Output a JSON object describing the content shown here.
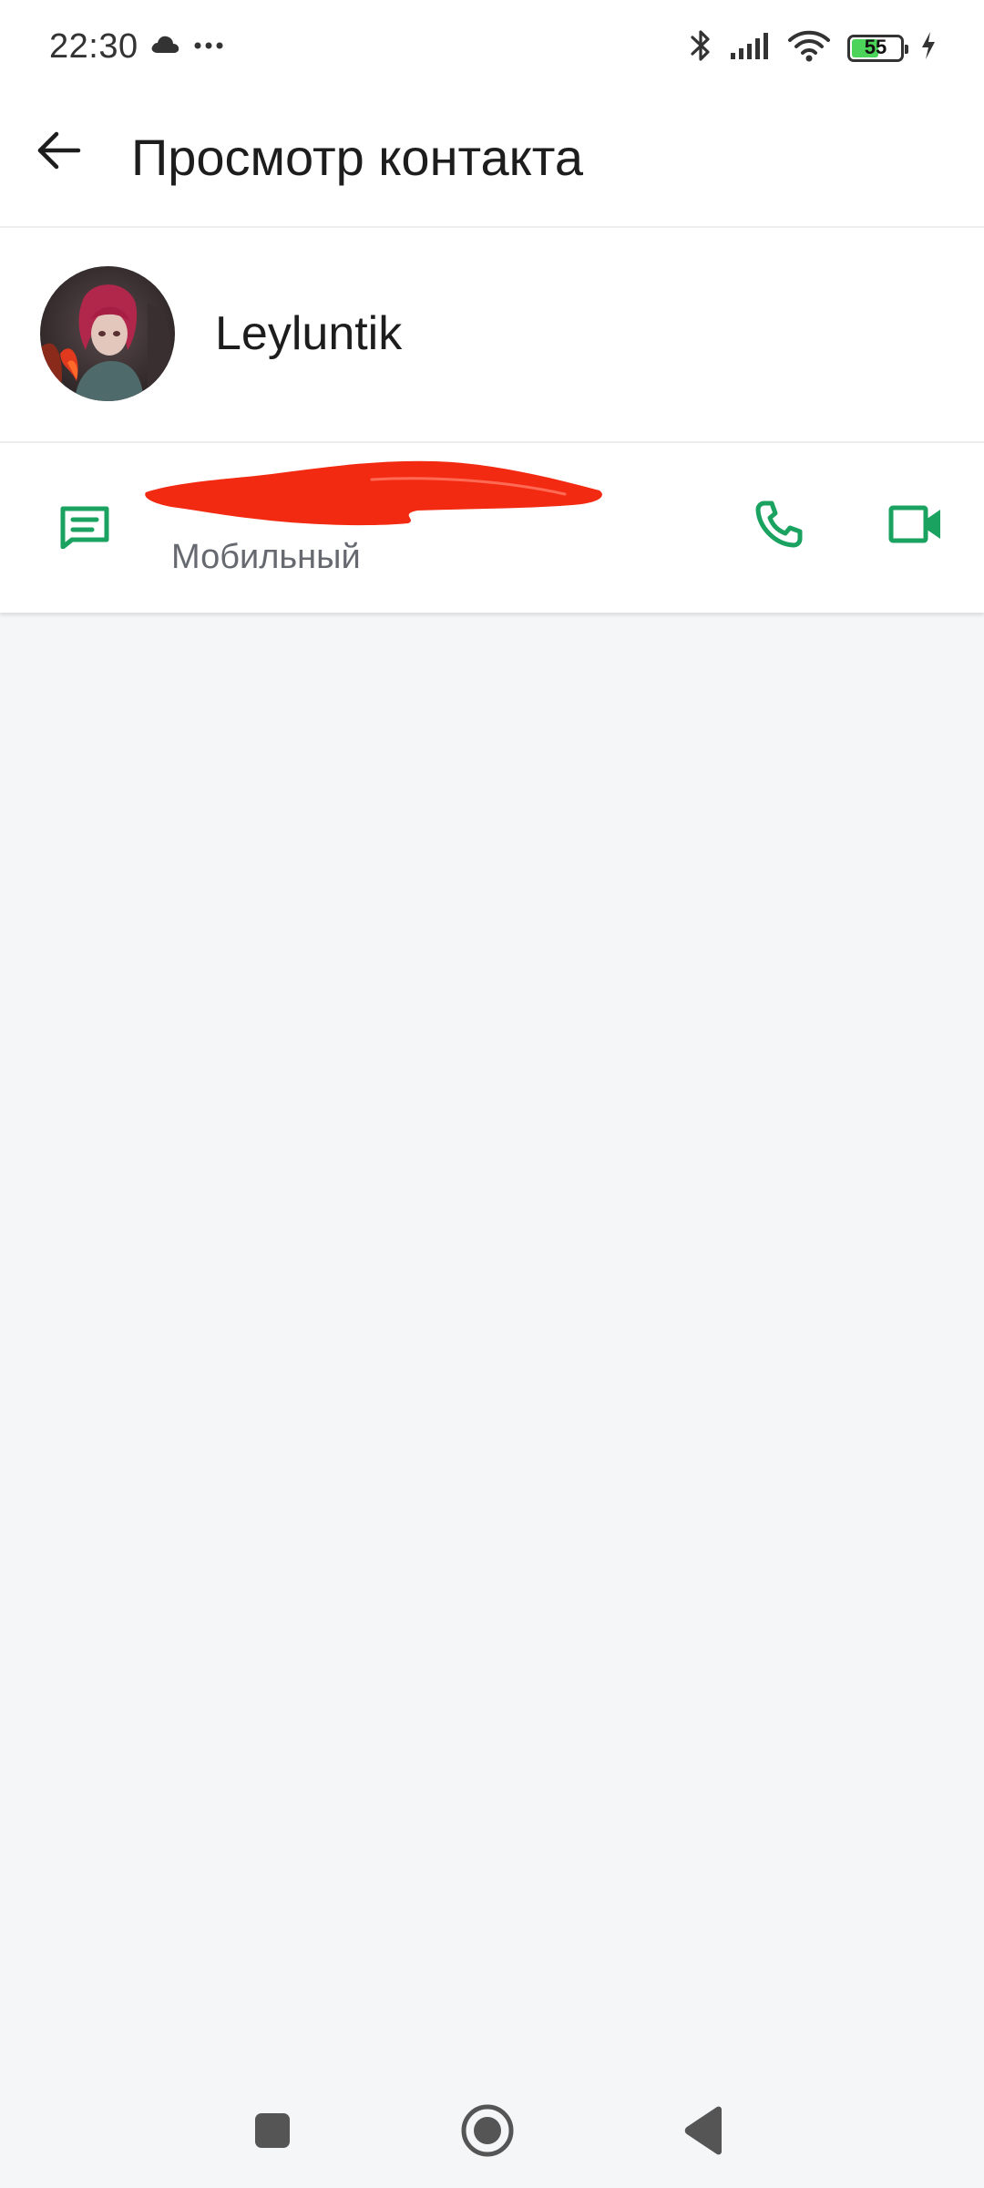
{
  "status_bar": {
    "time": "22:30",
    "battery_percent": "55",
    "battery_level": 0.55,
    "left_icons": [
      "cloud-icon",
      "more-dots-icon"
    ],
    "right_icons": [
      "bluetooth-icon",
      "signal-icon",
      "wifi-icon",
      "battery-icon",
      "charging-bolt-icon"
    ]
  },
  "app_bar": {
    "title": "Просмотр контакта",
    "back_icon": "arrow-left-icon"
  },
  "contact": {
    "name": "Leyluntik",
    "avatar": "avatar-image"
  },
  "phone_entry": {
    "number": "",
    "type_label": "Мобильный",
    "actions": [
      "message-icon",
      "phone-call-icon",
      "video-call-icon"
    ]
  },
  "colors": {
    "accent_green": "#1aa260",
    "battery_green": "#4cd35a",
    "redaction_red": "#f22a12",
    "background": "#f5f6f8"
  },
  "nav_bar": {
    "buttons": [
      "recent-apps-icon",
      "home-icon",
      "back-triangle-icon"
    ]
  }
}
